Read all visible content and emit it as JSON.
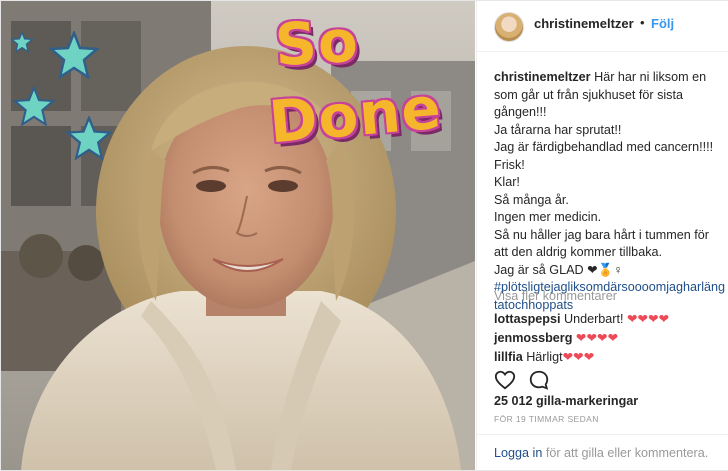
{
  "photo": {
    "sticker_line1": "So",
    "sticker_line2": "Done",
    "star_color": "#6fd3c4",
    "sticker_fill": "#f5b62c",
    "sticker_outline": "#c7439a"
  },
  "post": {
    "username": "christinemeltzer",
    "separator": "•",
    "follow_label": "Följ",
    "caption_username": "christinemeltzer",
    "caption_lines": [
      "Här har ni liksom en som går ut från sjukhuset för sista gången!!!",
      "Ja tårarna har sprutat!!",
      "Jag är färdigbehandlad med cancern!!!!",
      "Frisk!",
      "Klar!",
      "Så många år.",
      "Ingen mer medicin.",
      "Så nu håller jag bara hårt i tummen för att den aldrig kommer tillbaka.",
      "Jag är så GLAD ❤🏅♀",
      "#plötsligtejagliksomdärsoooomjagharlängtatochhoppats"
    ],
    "view_more_label": "Visa fler kommentarer",
    "comments": [
      {
        "user": "lottaspepsi",
        "text": "Underbart! ❤❤❤❤"
      },
      {
        "user": "jenmossberg",
        "text": "❤❤❤❤"
      },
      {
        "user": "lillfia",
        "text": "Härligt❤❤❤"
      }
    ],
    "actions": {
      "like_icon": "heart-outline-icon",
      "comment_icon": "comment-bubble-icon"
    },
    "likes_text": "25 012 gilla-markeringar",
    "timestamp": "FÖR 19 TIMMAR SEDAN",
    "login_link": "Logga in",
    "login_rest": " för att gilla eller kommentera."
  },
  "colors": {
    "link_blue": "#3897f0",
    "hashtag_blue": "#1f4f8a",
    "muted_gray": "#999999",
    "heart_red": "#ed4956"
  }
}
